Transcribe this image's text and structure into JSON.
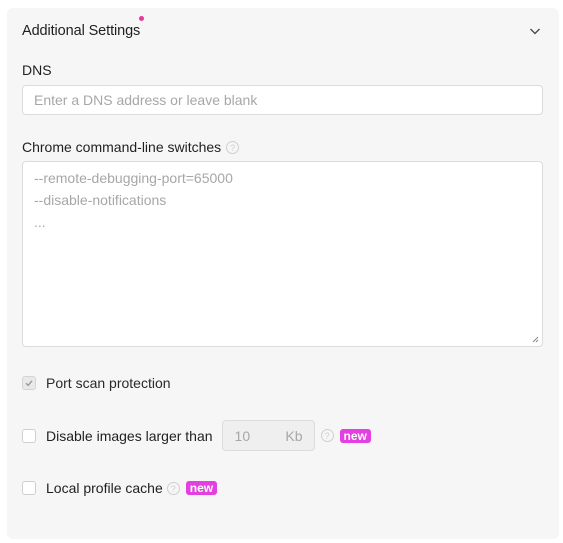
{
  "section": {
    "title": "Additional Settings",
    "toggle_icon": "chevron-down-icon"
  },
  "dns": {
    "label": "DNS",
    "placeholder": "Enter a DNS address or leave blank"
  },
  "chrome_switches": {
    "label": "Chrome command-line switches",
    "help_icon": "question-circle-icon",
    "placeholder_lines": [
      "--remote-debugging-port=65000",
      "--disable-notifications",
      "..."
    ]
  },
  "options": {
    "port_scan": {
      "label": "Port scan protection",
      "checked": true
    },
    "disable_images": {
      "label": "Disable images larger than",
      "checked": false,
      "value": "10",
      "unit": "Kb",
      "badge": "new"
    },
    "local_cache": {
      "label": "Local profile cache",
      "checked": false,
      "badge": "new"
    }
  },
  "colors": {
    "accent_dot": "#e5399e",
    "badge": "#e43fe0",
    "panel_bg": "#f6f6f6"
  }
}
